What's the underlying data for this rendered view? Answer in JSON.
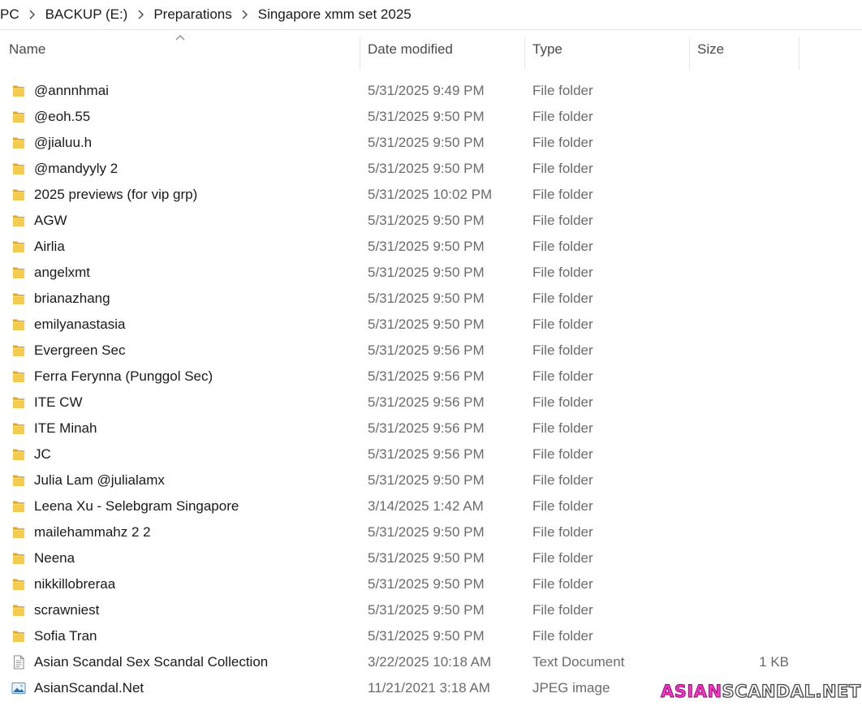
{
  "breadcrumb": [
    "PC",
    "BACKUP (E:)",
    "Preparations",
    "Singapore xmm set 2025"
  ],
  "columns": {
    "name": "Name",
    "date": "Date modified",
    "type": "Type",
    "size": "Size"
  },
  "files": [
    {
      "name": "@annnhmai",
      "date": "5/31/2025 9:49 PM",
      "type": "File folder",
      "size": "",
      "icon": "folder-icon"
    },
    {
      "name": "@eoh.55",
      "date": "5/31/2025 9:50 PM",
      "type": "File folder",
      "size": "",
      "icon": "folder-icon"
    },
    {
      "name": "@jialuu.h",
      "date": "5/31/2025 9:50 PM",
      "type": "File folder",
      "size": "",
      "icon": "folder-icon"
    },
    {
      "name": "@mandyyly 2",
      "date": "5/31/2025 9:50 PM",
      "type": "File folder",
      "size": "",
      "icon": "folder-icon"
    },
    {
      "name": "2025 previews (for vip grp)",
      "date": "5/31/2025 10:02 PM",
      "type": "File folder",
      "size": "",
      "icon": "folder-icon"
    },
    {
      "name": "AGW",
      "date": "5/31/2025 9:50 PM",
      "type": "File folder",
      "size": "",
      "icon": "folder-icon"
    },
    {
      "name": "Airlia",
      "date": "5/31/2025 9:50 PM",
      "type": "File folder",
      "size": "",
      "icon": "folder-icon"
    },
    {
      "name": "angelxmt",
      "date": "5/31/2025 9:50 PM",
      "type": "File folder",
      "size": "",
      "icon": "folder-icon"
    },
    {
      "name": "brianazhang",
      "date": "5/31/2025 9:50 PM",
      "type": "File folder",
      "size": "",
      "icon": "folder-icon"
    },
    {
      "name": "emilyanastasia",
      "date": "5/31/2025 9:50 PM",
      "type": "File folder",
      "size": "",
      "icon": "folder-icon"
    },
    {
      "name": "Evergreen Sec",
      "date": "5/31/2025 9:56 PM",
      "type": "File folder",
      "size": "",
      "icon": "folder-icon"
    },
    {
      "name": "Ferra Ferynna (Punggol Sec)",
      "date": "5/31/2025 9:56 PM",
      "type": "File folder",
      "size": "",
      "icon": "folder-icon"
    },
    {
      "name": "ITE CW",
      "date": "5/31/2025 9:56 PM",
      "type": "File folder",
      "size": "",
      "icon": "folder-icon"
    },
    {
      "name": "ITE Minah",
      "date": "5/31/2025 9:56 PM",
      "type": "File folder",
      "size": "",
      "icon": "folder-icon"
    },
    {
      "name": "JC",
      "date": "5/31/2025 9:56 PM",
      "type": "File folder",
      "size": "",
      "icon": "folder-icon"
    },
    {
      "name": "Julia Lam @julialamx",
      "date": "5/31/2025 9:50 PM",
      "type": "File folder",
      "size": "",
      "icon": "folder-icon"
    },
    {
      "name": "Leena Xu - Selebgram Singapore",
      "date": "3/14/2025 1:42 AM",
      "type": "File folder",
      "size": "",
      "icon": "folder-icon"
    },
    {
      "name": "mailehammahz 2 2",
      "date": "5/31/2025 9:50 PM",
      "type": "File folder",
      "size": "",
      "icon": "folder-icon"
    },
    {
      "name": "Neena",
      "date": "5/31/2025 9:50 PM",
      "type": "File folder",
      "size": "",
      "icon": "folder-icon"
    },
    {
      "name": "nikkillobreraa",
      "date": "5/31/2025 9:50 PM",
      "type": "File folder",
      "size": "",
      "icon": "folder-icon"
    },
    {
      "name": "scrawniest",
      "date": "5/31/2025 9:50 PM",
      "type": "File folder",
      "size": "",
      "icon": "folder-icon"
    },
    {
      "name": "Sofia Tran",
      "date": "5/31/2025 9:50 PM",
      "type": "File folder",
      "size": "",
      "icon": "folder-icon"
    },
    {
      "name": "Asian Scandal  Sex Scandal Collection",
      "date": "3/22/2025 10:18 AM",
      "type": "Text Document",
      "size": "1 KB",
      "icon": "text-file-icon"
    },
    {
      "name": "AsianScandal.Net",
      "date": "11/21/2021 3:18 AM",
      "type": "JPEG image",
      "size": "",
      "icon": "image-file-icon"
    }
  ],
  "watermark": {
    "part1": "ASIAN",
    "part2": "SCANDAL.NET"
  },
  "colors": {
    "folder": "#f0c44a",
    "folder_dark": "#e0a82e",
    "accent_pink": "#ff33cc"
  }
}
